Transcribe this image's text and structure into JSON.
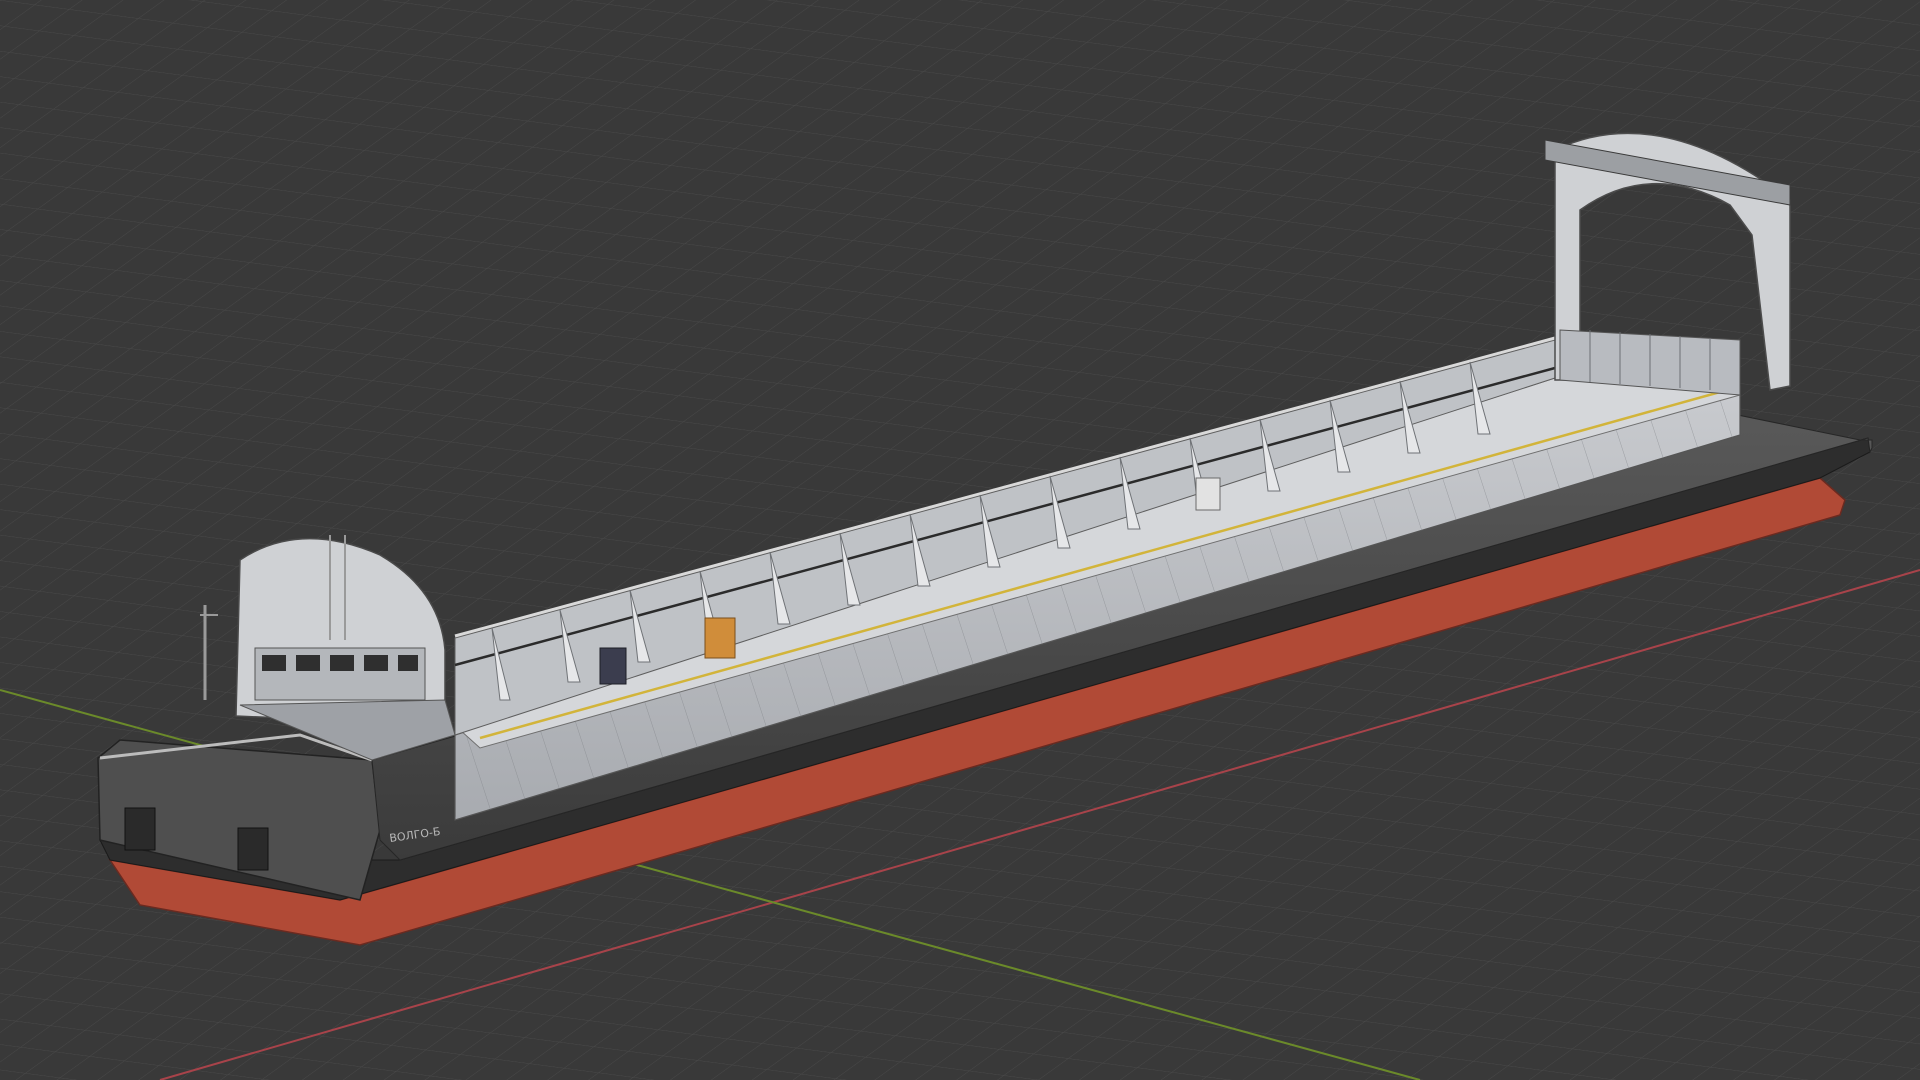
{
  "viewport": {
    "background_color": "#393939",
    "grid_color": "#4a4a4a",
    "x_axis_color": "#a8434a",
    "y_axis_color": "#6b8a2a"
  },
  "model": {
    "hull_name": "ВОЛГО-Б",
    "hull_red": "#b14a36",
    "hull_dark": "#2d2d2d",
    "superstructure": "#8a8a8a",
    "deck": "#b9bcc1",
    "cargo_box": "#d08d3a",
    "cargo_box_dark": "#3b3d4e"
  }
}
